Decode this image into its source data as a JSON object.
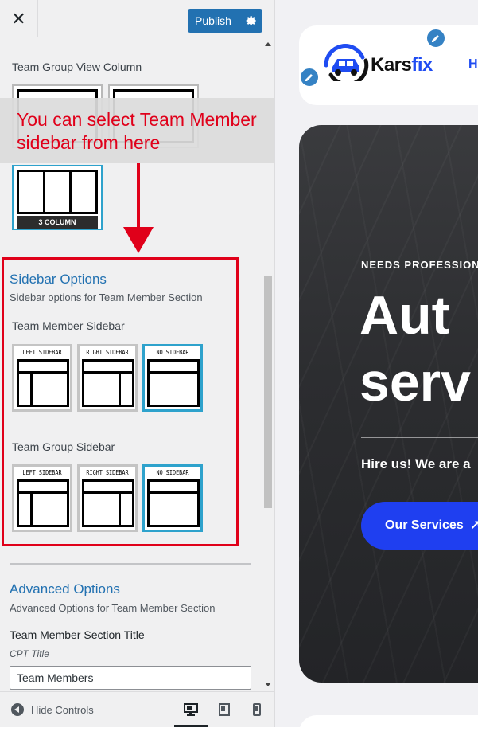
{
  "header": {
    "close_glyph": "✕",
    "publish_label": "Publish"
  },
  "team_group_view": {
    "label": "Team Group View Column",
    "col3_caption": "3 COLUMN"
  },
  "annotation": {
    "text": "You can select Team Member sidebar from here",
    "color": "#e0001a"
  },
  "sidebar_options": {
    "heading": "Sidebar Options",
    "description": "Sidebar options for Team Member Section",
    "member_label": "Team Member Sidebar",
    "group_label": "Team Group Sidebar",
    "options": [
      "LEFT SIDEBAR",
      "RIGHT SIDEBAR",
      "NO SIDEBAR"
    ],
    "selected": "NO SIDEBAR"
  },
  "advanced_options": {
    "heading": "Advanced Options",
    "description": "Advanced Options for Team Member Section",
    "title_label": "Team Member Section Title",
    "cpt_label": "CPT Title",
    "title_value": "Team Members"
  },
  "footer": {
    "hide_controls": "Hide Controls",
    "devices": [
      "desktop-icon",
      "tablet-icon",
      "mobile-icon"
    ]
  },
  "preview": {
    "logo_name": "Kars",
    "logo_accent": "fix",
    "nav_first": "H",
    "hero_kicker": "NEEDS PROFESSION",
    "hero_title_1": "Aut",
    "hero_title_2": "serv",
    "hero_sub": "Hire us! We are a",
    "cta_label": "Our Services",
    "cta_arrow": "↗"
  },
  "colors": {
    "wp_blue": "#2271b1",
    "brand_blue": "#1f4cf2",
    "cta_blue": "#1f3ff0",
    "selected_border": "#2ea2cc"
  }
}
